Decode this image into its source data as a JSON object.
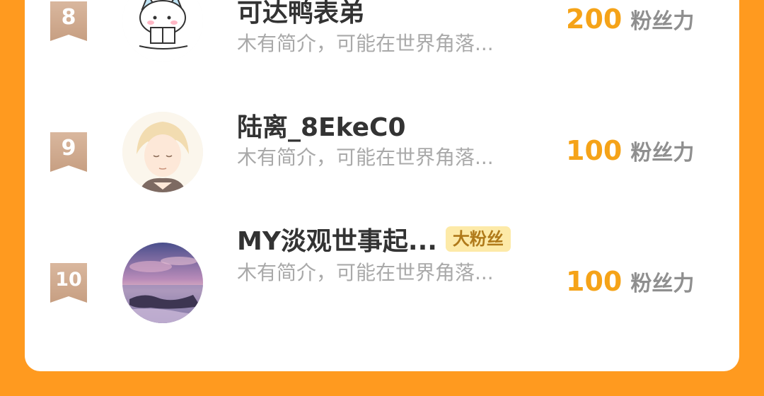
{
  "ranking": {
    "rows": [
      {
        "rank": "8",
        "name": "可达鸭表弟",
        "badge": "",
        "intro": "木有简介，可能在世界角落...",
        "score": "200",
        "score_unit": "粉丝力",
        "avatar_icon": "cartoon-cat-reading-icon"
      },
      {
        "rank": "9",
        "name": "陆离_8EkeC0",
        "badge": "",
        "intro": "木有简介，可能在世界角落...",
        "score": "100",
        "score_unit": "粉丝力",
        "avatar_icon": "anime-boy-avatar"
      },
      {
        "rank": "10",
        "name": "MY淡观世事起...",
        "badge": "大粉丝",
        "intro": "木有简介，可能在世界角落...",
        "score": "100",
        "score_unit": "粉丝力",
        "avatar_icon": "sunset-sea-avatar"
      }
    ]
  },
  "colors": {
    "background": "#ff9a1f",
    "score": "#f5a318",
    "rank_ribbon": "#c9a286",
    "badge_bg": "#fdeaa8"
  }
}
